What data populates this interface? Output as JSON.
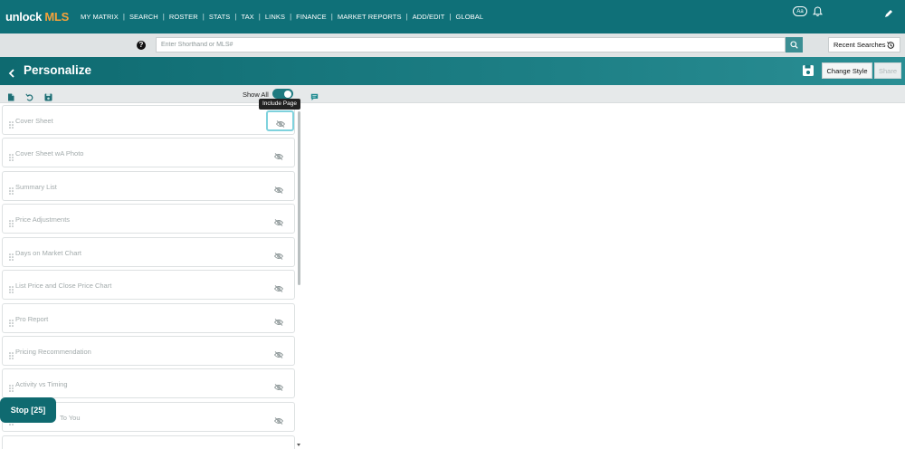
{
  "nav": {
    "logo_part1": "unlock",
    "logo_part2": "MLS",
    "links": [
      "MY MATRIX",
      "SEARCH",
      "ROSTER",
      "STATS",
      "TAX",
      "LINKS",
      "FINANCE",
      "MARKET REPORTS",
      "ADD/EDIT",
      "GLOBAL"
    ],
    "font_size_label": "Aa"
  },
  "search": {
    "placeholder": "Enter Shorthand or MLS#",
    "recent_label": "Recent Searches"
  },
  "titlebar": {
    "back_label": "<",
    "title": "Personalize",
    "change_style_label": "Change Style",
    "share_label": "Share"
  },
  "toolbar": {
    "show_all_label": "Show All",
    "show_all_on": true,
    "tooltip": "Include Page"
  },
  "pages": [
    {
      "label": "Cover Sheet"
    },
    {
      "label": "Cover Sheet wA Photo"
    },
    {
      "label": "Summary List"
    },
    {
      "label": "Price Adjustments"
    },
    {
      "label": "Days on Market Chart"
    },
    {
      "label": "List Price and Close Price Chart"
    },
    {
      "label": "Pro Report"
    },
    {
      "label": "Pricing Recommendation"
    },
    {
      "label": "Activity vs Timing"
    },
    {
      "label": "To You"
    }
  ],
  "stop_button": {
    "label": "Stop [25]"
  },
  "colors": {
    "nav_bg": "#0f7078",
    "accent": "#f5a23a",
    "toggle": "#1f7a80"
  }
}
